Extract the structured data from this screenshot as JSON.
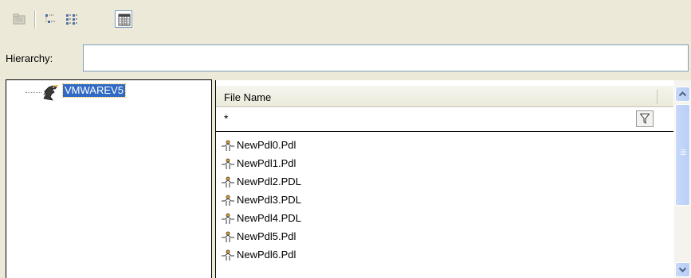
{
  "toolbar": {
    "buttons": [
      {
        "icon": "folder-icon",
        "state": "disabled"
      },
      {
        "icon": "tree-view-icon",
        "state": "normal"
      },
      {
        "icon": "list-view-icon",
        "state": "normal"
      },
      {
        "icon": "details-view-icon",
        "state": "pressed"
      }
    ]
  },
  "hierarchy": {
    "label": "Hierarchy:",
    "value": ""
  },
  "tree": {
    "node_label": "VMWAREV5",
    "node_icon": "server-eagle-icon",
    "selected": true
  },
  "list": {
    "column_header": "File Name",
    "filter_value": "*",
    "filter_icon": "funnel-icon",
    "files": [
      {
        "name": "NewPdl0.Pdl",
        "icon": "pdl-file-icon"
      },
      {
        "name": "NewPdl1.Pdl",
        "icon": "pdl-file-icon"
      },
      {
        "name": "NewPdl2.PDL",
        "icon": "pdl-file-icon"
      },
      {
        "name": "NewPdl3.PDL",
        "icon": "pdl-file-icon"
      },
      {
        "name": "NewPdl4.PDL",
        "icon": "pdl-file-icon"
      },
      {
        "name": "NewPdl5.Pdl",
        "icon": "pdl-file-icon"
      },
      {
        "name": "NewPdl6.Pdl",
        "icon": "pdl-file-icon"
      }
    ]
  },
  "colors": {
    "window_bg": "#ece9d8",
    "selection_bg": "#316ac5",
    "selection_text": "#ffffff",
    "scrollbar_accent": "#c8d9f8"
  }
}
